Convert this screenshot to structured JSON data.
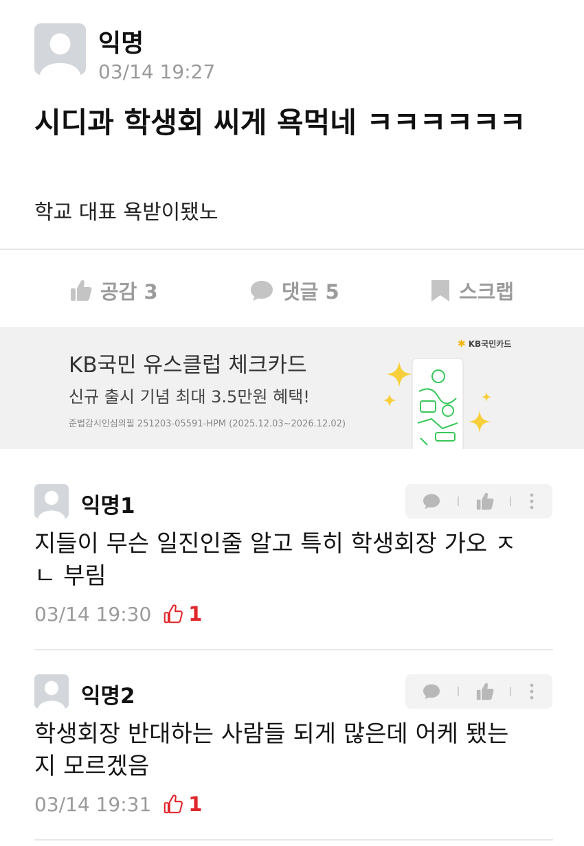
{
  "post": {
    "author": "익명",
    "time": "03/14 19:27",
    "title": "시디과 학생회 씨게 욕먹네 ㅋㅋㅋㅋㅋㅋ",
    "body": "학교 대표 욕받이됐노"
  },
  "actions": {
    "like_label": "공감 3",
    "comment_label": "댓글 5",
    "scrap_label": "스크랩"
  },
  "ad": {
    "brand": "KB국민카드",
    "title": "KB국민 유스클럽 체크카드",
    "subtitle": "신규 출시 기념 최대 3.5만원 혜택!",
    "note": "준법감시인심의필 251203-05591-HPM (2025.12.03~2026.12.02)"
  },
  "comments": [
    {
      "author": "익명1",
      "text": "지들이 무슨 일진인줄 알고 특히 학생회장 가오 ㅈㄴ 부림",
      "time": "03/14 19:30",
      "likes": "1"
    },
    {
      "author": "익명2",
      "text": "학생회장 반대하는 사람들 되게 많은데 어케 됐는지 모르겠음",
      "time": "03/14 19:31",
      "likes": "1"
    }
  ],
  "icons": {
    "avatar": "default-avatar-icon",
    "like": "thumbs-up-icon",
    "comment": "speech-bubble-icon",
    "scrap": "bookmark-icon",
    "more": "vertical-dots-icon",
    "like_outline": "thumbs-up-outline-icon"
  },
  "colors": {
    "accent_red": "#e0262b",
    "muted_gray": "#9b9b9b",
    "ad_background": "#f1f1f1",
    "kb_yellow": "#f2b600",
    "card_green": "#38c85a"
  }
}
